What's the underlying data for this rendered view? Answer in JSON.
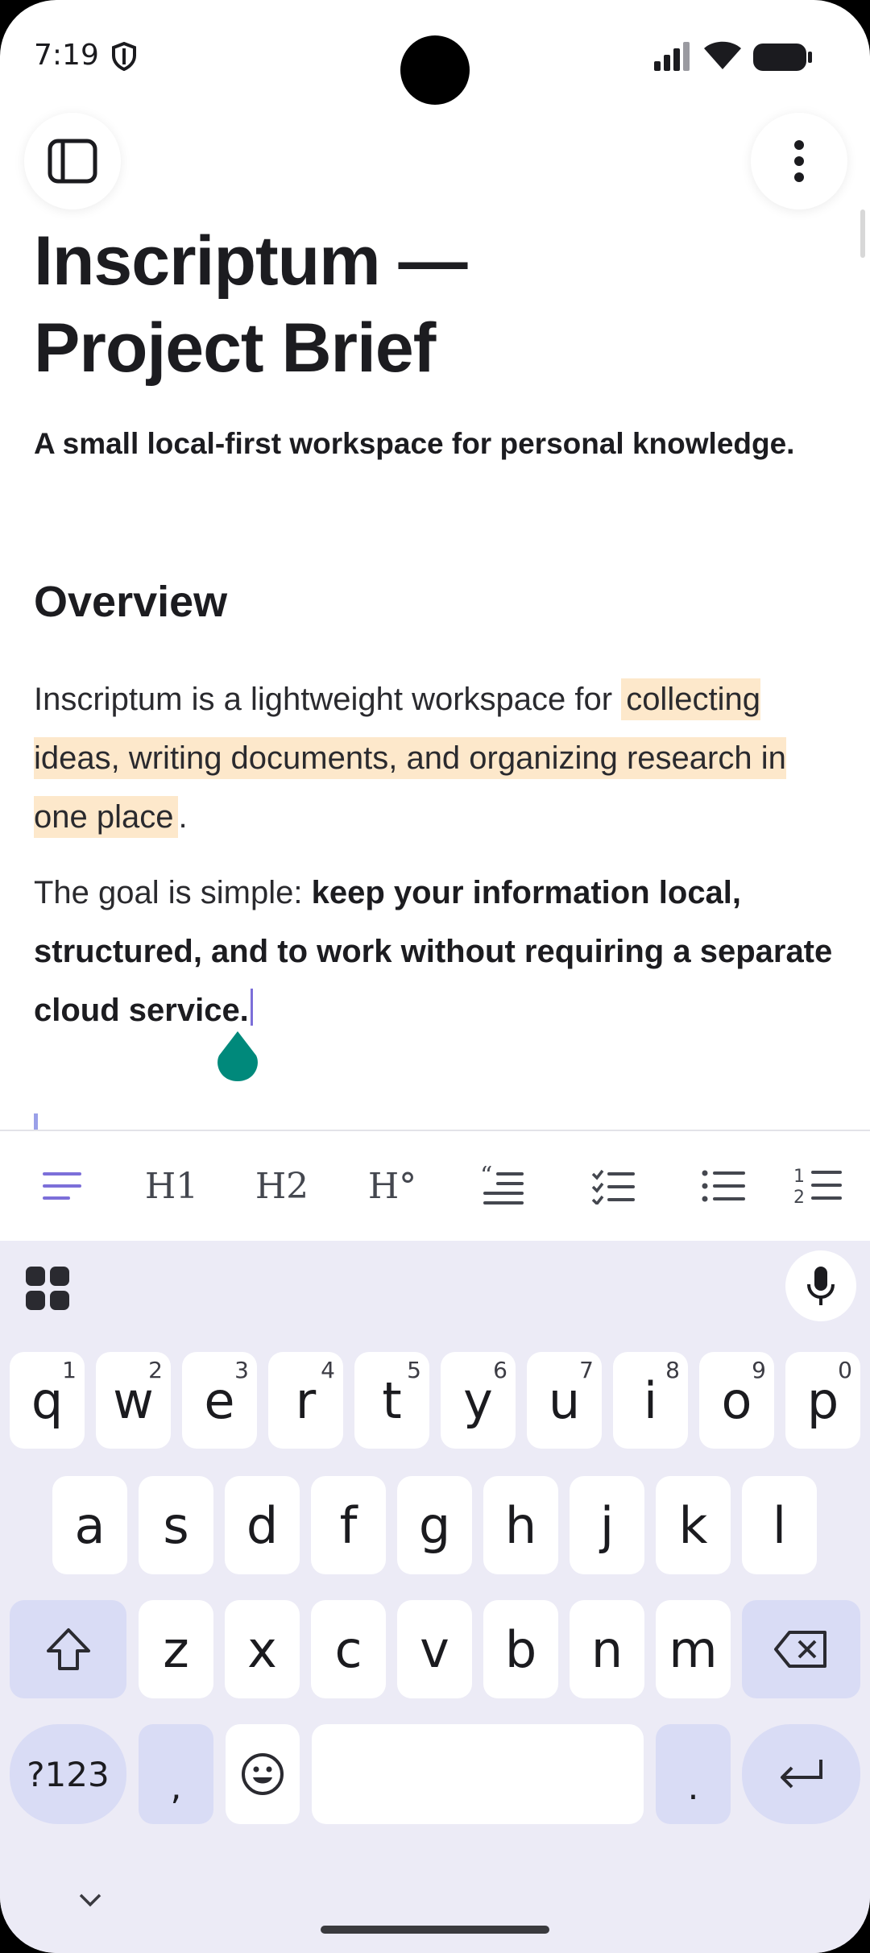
{
  "status_bar": {
    "time": "7:19"
  },
  "document": {
    "title": "Inscriptum — Project Brief",
    "subtitle": "A small local-first workspace for personal knowledge.",
    "heading": "Overview",
    "p1_before": "Inscriptum is a lightweight workspace for ",
    "p1_highlight": "collecting ideas, writing documents, and organizing research in one place",
    "p1_after": ".",
    "p2_before": "The goal is simple: ",
    "p2_bold": "keep your information local, structured, and to work without requiring a separate cloud service."
  },
  "toolbar": {
    "items": [
      "paragraph-icon",
      "H1",
      "H2",
      "H°",
      "quote-icon",
      "checklist-icon",
      "bullet-list-icon",
      "numbered-list-icon"
    ],
    "h1": "H1",
    "h2": "H2",
    "h3": "H°"
  },
  "keyboard": {
    "row1": [
      {
        "k": "q",
        "h": "1"
      },
      {
        "k": "w",
        "h": "2"
      },
      {
        "k": "e",
        "h": "3"
      },
      {
        "k": "r",
        "h": "4"
      },
      {
        "k": "t",
        "h": "5"
      },
      {
        "k": "y",
        "h": "6"
      },
      {
        "k": "u",
        "h": "7"
      },
      {
        "k": "i",
        "h": "8"
      },
      {
        "k": "o",
        "h": "9"
      },
      {
        "k": "p",
        "h": "0"
      }
    ],
    "row2": [
      "a",
      "s",
      "d",
      "f",
      "g",
      "h",
      "j",
      "k",
      "l"
    ],
    "row3": [
      "z",
      "x",
      "c",
      "v",
      "b",
      "n",
      "m"
    ],
    "symbols": "?123",
    "comma": ",",
    "period": "."
  },
  "colors": {
    "accent": "#7c6fd9",
    "highlight": "#fde8cb",
    "handle": "#00897b",
    "keyboard_bg": "#ecebf6",
    "mod_key": "#d9dcf5"
  }
}
